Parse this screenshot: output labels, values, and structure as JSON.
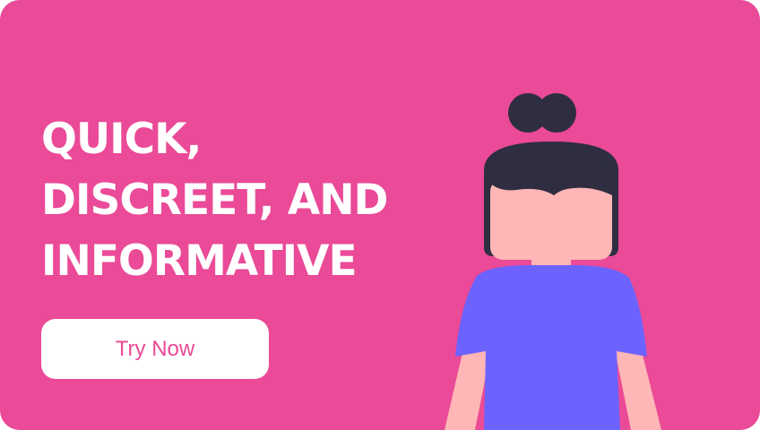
{
  "banner": {
    "headline_lines": [
      "QUICK,",
      "DISCREET, AND",
      "INFORMATIVE"
    ],
    "cta_label": "Try Now",
    "background_color": "#ea4a97",
    "cta_text_color": "#ea4a97"
  },
  "illustration": {
    "icon": "woman-avatar-icon",
    "hair_color": "#2f2e41",
    "skin_color": "#ffb6b6",
    "shirt_color": "#6c63ff"
  }
}
